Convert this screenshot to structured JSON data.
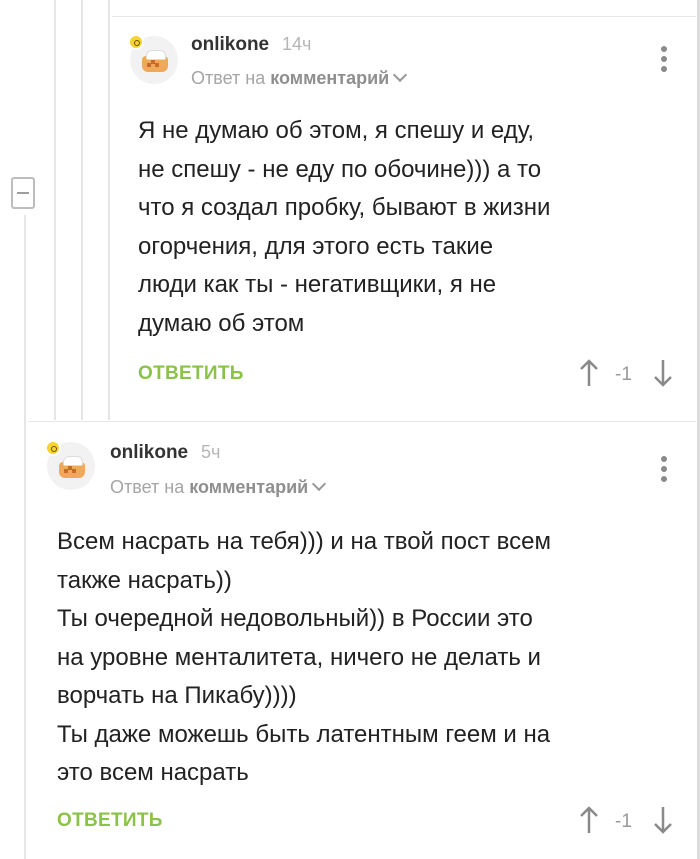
{
  "comments": [
    {
      "username": "onlikone",
      "time": "14ч",
      "reply_to_prefix": "Ответ на",
      "reply_to_target": "комментарий",
      "text": "Я не думаю об этом, я спешу и еду,\nне спешу - не еду по обочине))) а то\nчто я создал пробку, бывают в жизни\nогорчения, для этого есть такие\nлюди как ты - негативщики, я не\nдумаю об этом",
      "reply_label": "ОТВЕТИТЬ",
      "rating": "-1"
    },
    {
      "username": "onlikone",
      "time": "5ч",
      "reply_to_prefix": "Ответ на",
      "reply_to_target": "комментарий",
      "text": "Всем насрать на тебя))) и на твой пост всем\nтакже насрать))\nТы очередной недовольный)) в России это\nна уровне менталитета, ничего не делать и\nворчать на Пикабу))))\nТы даже можешь быть латентным геем и на\nэто всем насрать",
      "reply_label": "ОТВЕТИТЬ",
      "rating": "-1"
    }
  ],
  "colors": {
    "accent_green": "#8bc34a",
    "muted_gray": "#a5a5a5",
    "text": "#222222"
  }
}
